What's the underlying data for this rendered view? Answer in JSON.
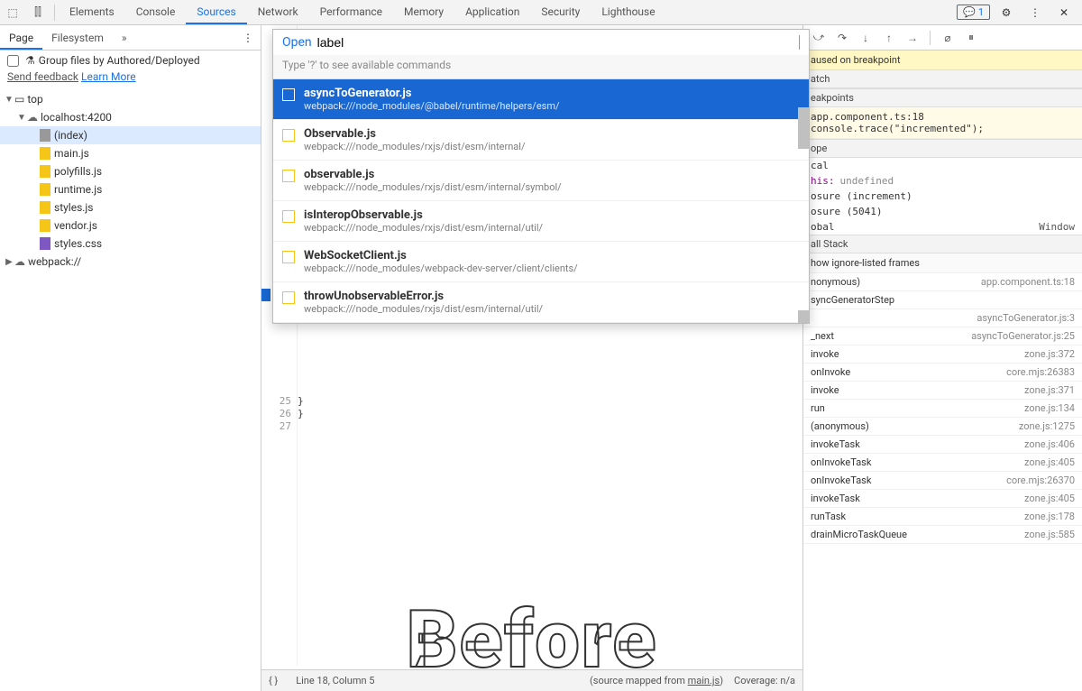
{
  "topbar": {
    "tabs": [
      "Elements",
      "Console",
      "Sources",
      "Network",
      "Performance",
      "Memory",
      "Application",
      "Security",
      "Lighthouse"
    ],
    "active_tab": "Sources",
    "feedback_count": "1"
  },
  "left": {
    "tabs": [
      "Page",
      "Filesystem"
    ],
    "active": "Page",
    "group_label": "Group files by Authored/Deployed",
    "send_feedback": "Send feedback",
    "learn_more": "Learn More",
    "tree": {
      "top": "top",
      "host": "localhost:4200",
      "files": [
        "(index)",
        "main.js",
        "polyfills.js",
        "runtime.js",
        "styles.js",
        "vendor.js",
        "styles.css"
      ],
      "webpack": "webpack://"
    }
  },
  "quick_open": {
    "open_label": "Open",
    "query": "label",
    "hint": "Type '?' to see available commands",
    "items": [
      {
        "title": "asyncToGenerator.js",
        "path": "webpack:///node_modules/@babel/runtime/helpers/esm/",
        "selected": true
      },
      {
        "title": "Observable.js",
        "path": "webpack:///node_modules/rxjs/dist/esm/internal/"
      },
      {
        "title": "observable.js",
        "path": "webpack:///node_modules/rxjs/dist/esm/internal/symbol/"
      },
      {
        "title": "isInteropObservable.js",
        "path": "webpack:///node_modules/rxjs/dist/esm/internal/util/"
      },
      {
        "title": "WebSocketClient.js",
        "path": "webpack:///node_modules/webpack-dev-server/client/clients/"
      },
      {
        "title": "throwUnobservableError.js",
        "path": "webpack:///node_modules/rxjs/dist/esm/internal/util/"
      }
    ]
  },
  "code": {
    "gutter": [
      "25",
      "26",
      "27"
    ],
    "lines": [
      "  }",
      "}",
      ""
    ]
  },
  "watermark": "Before",
  "status": {
    "line_col": "Line 18, Column 5",
    "mapped_prefix": "(source mapped from ",
    "mapped_file": "main.js",
    "mapped_suffix": ")",
    "coverage": "Coverage: n/a"
  },
  "right": {
    "pause_msg": "aused on breakpoint",
    "sections": {
      "watch": "atch",
      "breakpoints": "eakpoints",
      "scope": "ope",
      "call_stack": "all Stack"
    },
    "bp": {
      "file": "app.component.ts:18",
      "code": "console.trace(\"incremented\");"
    },
    "scope": {
      "local": "cal",
      "this_label": "his:",
      "this_val": "undefined",
      "closure1": "osure (increment)",
      "closure2": "osure (5041)",
      "global": "obal",
      "global_val": "Window"
    },
    "ignore_row": "how ignore-listed frames",
    "stack": [
      {
        "fn": "nonymous)",
        "loc": "app.component.ts:18"
      },
      {
        "fn": "syncGeneratorStep",
        "loc": ""
      },
      {
        "fn": "",
        "loc": "asyncToGenerator.js:3"
      },
      {
        "fn": "_next",
        "loc": "asyncToGenerator.js:25"
      },
      {
        "fn": "invoke",
        "loc": "zone.js:372"
      },
      {
        "fn": "onInvoke",
        "loc": "core.mjs:26383"
      },
      {
        "fn": "invoke",
        "loc": "zone.js:371"
      },
      {
        "fn": "run",
        "loc": "zone.js:134"
      },
      {
        "fn": "(anonymous)",
        "loc": "zone.js:1275"
      },
      {
        "fn": "invokeTask",
        "loc": "zone.js:406"
      },
      {
        "fn": "onInvokeTask",
        "loc": "zone.js:405"
      },
      {
        "fn": "onInvokeTask",
        "loc": "core.mjs:26370"
      },
      {
        "fn": "invokeTask",
        "loc": "zone.js:405"
      },
      {
        "fn": "runTask",
        "loc": "zone.js:178"
      },
      {
        "fn": "drainMicroTaskQueue",
        "loc": "zone.js:585"
      }
    ]
  }
}
